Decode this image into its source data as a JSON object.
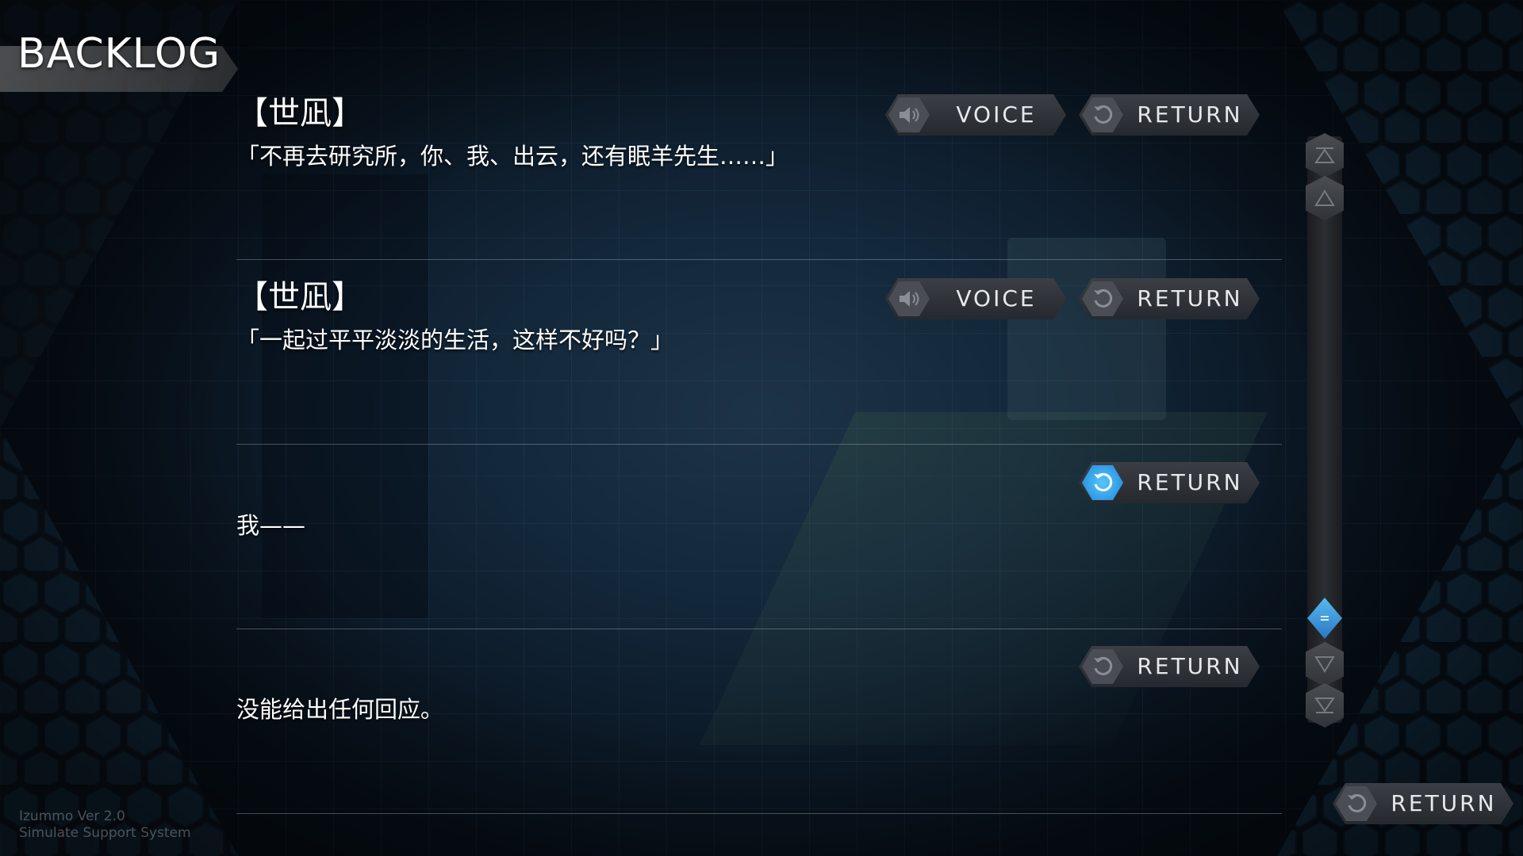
{
  "screen_title": "BACKLOG",
  "entries": [
    {
      "speaker": "【世凪】",
      "text": "「不再去研究所，你、我、出云，还有眠羊先生……」",
      "voice_label": "VOICE",
      "return_label": "RETURN"
    },
    {
      "speaker": "【世凪】",
      "text": "「一起过平平淡淡的生活，这样不好吗？」",
      "voice_label": "VOICE",
      "return_label": "RETURN"
    },
    {
      "speaker": "",
      "text": "我——",
      "return_label": "RETURN",
      "return_active": true
    },
    {
      "speaker": "",
      "text": "没能给出任何回应。",
      "return_label": "RETURN"
    }
  ],
  "footer": {
    "version_line1": "Izummo Ver 2.0",
    "version_line2": "Simulate Support System",
    "return_label": "RETURN"
  },
  "icons": {
    "voice": "speaker-icon",
    "return": "return-arrow-icon",
    "scroll_top": "double-up-arrow-icon",
    "scroll_up": "up-arrow-icon",
    "scroll_down": "down-arrow-icon",
    "scroll_bottom": "double-down-arrow-icon",
    "scroll_thumb": "scroll-thumb-icon"
  },
  "colors": {
    "accent_active": "#3aa8f0",
    "honeycomb": "#2e7fb8",
    "button_bg": "#2f3338"
  }
}
